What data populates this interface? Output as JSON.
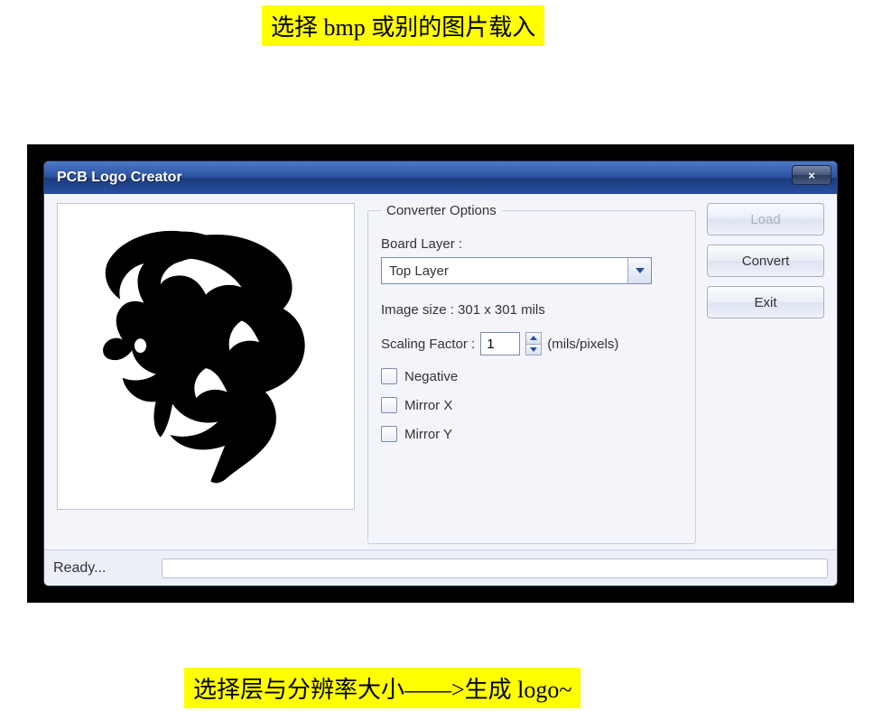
{
  "annotations": {
    "top": "选择 bmp 或别的图片载入",
    "bottom": "选择层与分辨率大小——>生成 logo~"
  },
  "window": {
    "title": "PCB Logo Creator",
    "close_label": "×"
  },
  "options": {
    "legend": "Converter Options",
    "board_layer_label": "Board Layer :",
    "board_layer_value": "Top Layer",
    "image_size": "Image size : 301 x 301 mils",
    "scaling_label": "Scaling Factor :",
    "scaling_value": "1",
    "scaling_units": "(mils/pixels)",
    "negative_label": "Negative",
    "mirrorx_label": "Mirror X",
    "mirrory_label": "Mirror Y"
  },
  "buttons": {
    "load": "Load",
    "convert": "Convert",
    "exit": "Exit"
  },
  "status": {
    "text": "Ready..."
  }
}
